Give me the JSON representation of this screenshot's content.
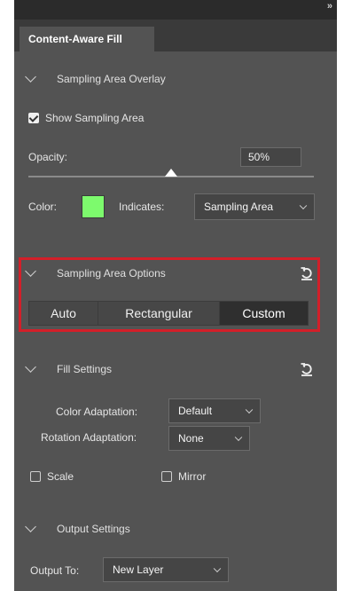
{
  "panel": {
    "collapse_glyph": "»",
    "tab_title": "Content-Aware Fill"
  },
  "overlay": {
    "header": "Sampling Area Overlay",
    "show_sampling_label": "Show Sampling Area",
    "show_sampling_checked": true,
    "opacity_label": "Opacity:",
    "opacity_value": "50%",
    "opacity_fraction": 0.5,
    "color_label": "Color:",
    "swatch_color": "#7dfa6d",
    "indicates_label": "Indicates:",
    "indicates_value": "Sampling Area"
  },
  "options": {
    "header": "Sampling Area Options",
    "buttons": [
      "Auto",
      "Rectangular",
      "Custom"
    ],
    "active": "Custom"
  },
  "fill": {
    "header": "Fill Settings",
    "color_adaptation_label": "Color Adaptation:",
    "color_adaptation_value": "Default",
    "rotation_adaptation_label": "Rotation Adaptation:",
    "rotation_adaptation_value": "None",
    "scale_label": "Scale",
    "scale_checked": false,
    "mirror_label": "Mirror",
    "mirror_checked": false
  },
  "output": {
    "header": "Output Settings",
    "output_to_label": "Output To:",
    "output_to_value": "New Layer"
  },
  "colors": {
    "highlight": "#d31f29",
    "panel_bg": "#535353"
  }
}
